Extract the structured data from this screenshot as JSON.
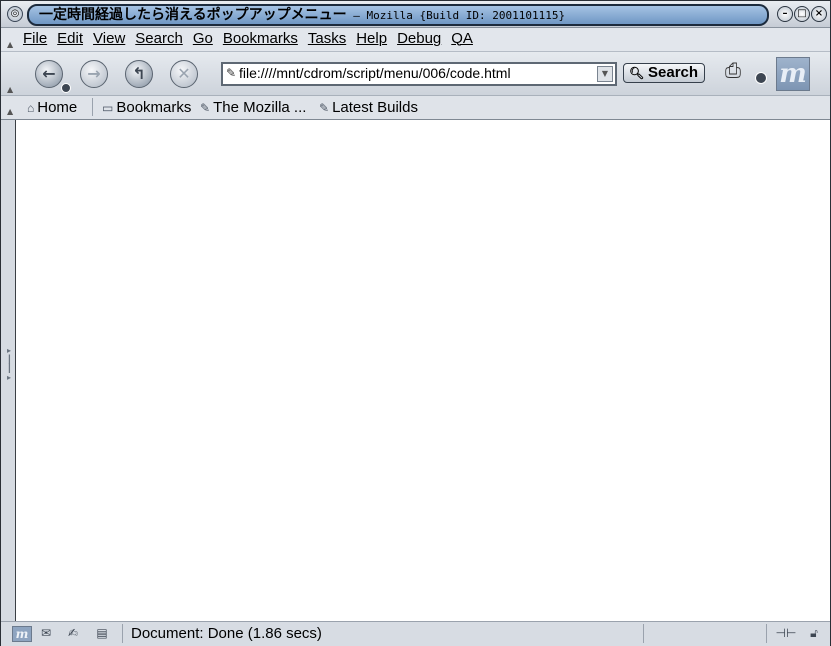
{
  "window": {
    "title": "一定時間経過したら消えるポップアップメニュー",
    "app_name": " – Mozilla {Build ID: 2001101115}"
  },
  "menubar": {
    "items": [
      "File",
      "Edit",
      "View",
      "Search",
      "Go",
      "Bookmarks",
      "Tasks",
      "Help",
      "Debug",
      "QA"
    ]
  },
  "navbar": {
    "url": "file:////mnt/cdrom/script/menu/006/code.html",
    "search_label": "Search"
  },
  "personal_toolbar": {
    "home": "Home",
    "bookmarks": "Bookmarks",
    "mozilla": "The Mozilla ...",
    "latest_builds": "Latest Builds"
  },
  "status": {
    "text": "Document: Done (1.86 secs)"
  },
  "icons": {
    "throbber": "m",
    "status_m": "m"
  }
}
